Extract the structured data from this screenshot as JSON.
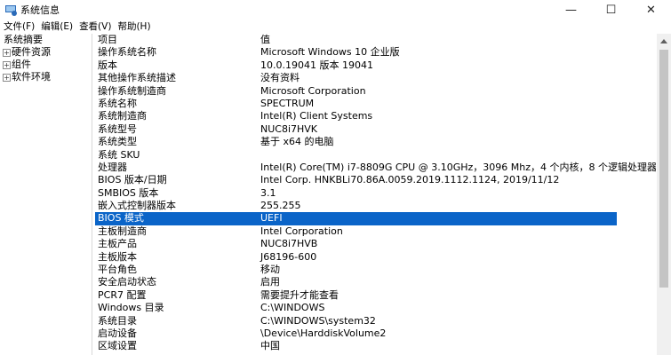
{
  "window": {
    "title": "系统信息"
  },
  "window_controls": {
    "minimize": "—",
    "maximize": "☐",
    "close": "✕"
  },
  "menu": [
    "文件(F)",
    "编辑(E)",
    "查看(V)",
    "帮助(H)"
  ],
  "tree": [
    {
      "label": "系统摘要",
      "expander": ""
    },
    {
      "label": "硬件资源",
      "expander": "+"
    },
    {
      "label": "组件",
      "expander": "+"
    },
    {
      "label": "软件环境",
      "expander": "+"
    }
  ],
  "table": {
    "headers": [
      "项目",
      "值"
    ],
    "selected_index": 14,
    "rows": [
      [
        "操作系统名称",
        "Microsoft Windows 10 企业版"
      ],
      [
        "版本",
        "10.0.19041 版本 19041"
      ],
      [
        "其他操作系统描述",
        "没有资料"
      ],
      [
        "操作系统制造商",
        "Microsoft Corporation"
      ],
      [
        "系统名称",
        "SPECTRUM"
      ],
      [
        "系统制造商",
        "Intel(R) Client Systems"
      ],
      [
        "系统型号",
        "NUC8i7HVK"
      ],
      [
        "系统类型",
        "基于 x64 的电脑"
      ],
      [
        "系统 SKU",
        ""
      ],
      [
        "处理器",
        "Intel(R) Core(TM) i7-8809G CPU @ 3.10GHz，3096 Mhz，4 个内核，8 个逻辑处理器"
      ],
      [
        "BIOS 版本/日期",
        "Intel Corp. HNKBLi70.86A.0059.2019.1112.1124, 2019/11/12"
      ],
      [
        "SMBIOS 版本",
        "3.1"
      ],
      [
        "嵌入式控制器版本",
        "255.255"
      ],
      [
        "BIOS 模式",
        "UEFI"
      ],
      [
        "主板制造商",
        "Intel Corporation"
      ],
      [
        "主板产品",
        "NUC8i7HVB"
      ],
      [
        "主板版本",
        "J68196-600"
      ],
      [
        "平台角色",
        "移动"
      ],
      [
        "安全启动状态",
        "启用"
      ],
      [
        "PCR7 配置",
        "需要提升才能查看"
      ],
      [
        "Windows 目录",
        "C:\\WINDOWS"
      ],
      [
        "系统目录",
        "C:\\WINDOWS\\system32"
      ],
      [
        "启动设备",
        "\\Device\\HarddiskVolume2"
      ],
      [
        "区域设置",
        "中国"
      ]
    ]
  },
  "scrollbar": {
    "position_fraction": 0.0,
    "visible_fraction": 0.78
  },
  "colors": {
    "selection": "#0a64c8"
  }
}
